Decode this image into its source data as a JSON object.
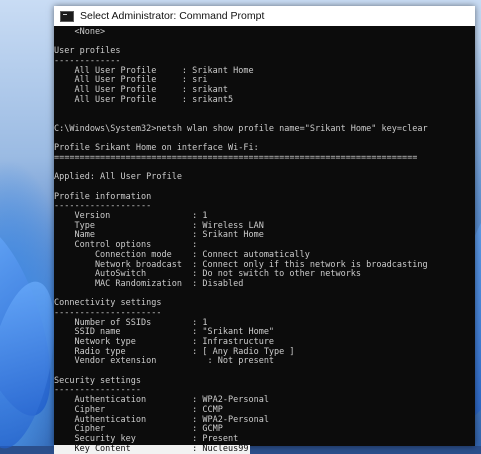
{
  "window": {
    "title": "Select Administrator: Command Prompt"
  },
  "console": {
    "lines": [
      "    <None>",
      "",
      "User profiles",
      "-------------",
      "    All User Profile     : Srikant Home",
      "    All User Profile     : sri",
      "    All User Profile     : srikant",
      "    All User Profile     : srikant5",
      "",
      "",
      "C:\\Windows\\System32>netsh wlan show profile name=\"Srikant Home\" key=clear",
      "",
      "Profile Srikant Home on interface Wi-Fi:",
      "=======================================================================",
      "",
      "Applied: All User Profile",
      "",
      "Profile information",
      "-------------------",
      "    Version                : 1",
      "    Type                   : Wireless LAN",
      "    Name                   : Srikant Home",
      "    Control options        :",
      "        Connection mode    : Connect automatically",
      "        Network broadcast  : Connect only if this network is broadcasting",
      "        AutoSwitch         : Do not switch to other networks",
      "        MAC Randomization  : Disabled",
      "",
      "Connectivity settings",
      "---------------------",
      "    Number of SSIDs        : 1",
      "    SSID name              : \"Srikant Home\"",
      "    Network type           : Infrastructure",
      "    Radio type             : [ Any Radio Type ]",
      "    Vendor extension          : Not present",
      "",
      "Security settings",
      "-----------------",
      "    Authentication         : WPA2-Personal",
      "    Cipher                 : CCMP",
      "    Authentication         : WPA2-Personal",
      "    Cipher                 : GCMP",
      "    Security key           : Present",
      "    Key Content            : Nucleus99"
    ],
    "highlighted_line_index": 43
  }
}
